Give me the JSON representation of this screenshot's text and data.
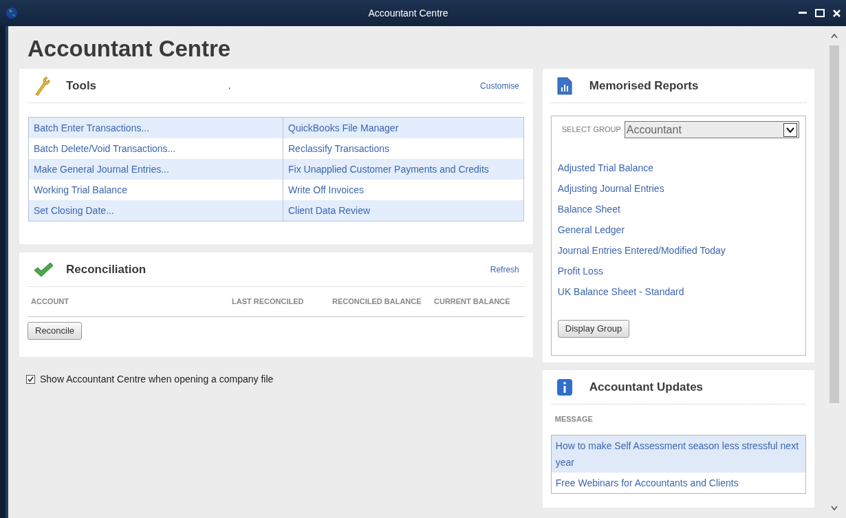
{
  "window": {
    "title": "Accountant Centre"
  },
  "heading": "Accountant Centre",
  "tools": {
    "title": "Tools",
    "marker": ".",
    "customise": "Customise",
    "rows": [
      [
        "Batch Enter Transactions...",
        "QuickBooks File Manager"
      ],
      [
        "Batch Delete/Void Transactions...",
        "Reclassify Transactions"
      ],
      [
        "Make General Journal Entries...",
        "Fix Unapplied Customer Payments and Credits"
      ],
      [
        "Working Trial Balance",
        "Write Off Invoices"
      ],
      [
        "Set Closing Date...",
        "Client Data Review"
      ]
    ]
  },
  "reconciliation": {
    "title": "Reconciliation",
    "refresh": "Refresh",
    "columns": [
      "ACCOUNT",
      "LAST RECONCILED",
      "RECONCILED BALANCE",
      "CURRENT BALANCE"
    ],
    "button": "Reconcile"
  },
  "show_on_open": {
    "label": "Show Accountant Centre when opening a company file",
    "checked": true
  },
  "memorised_reports": {
    "title": "Memorised Reports",
    "select_label": "SELECT GROUP",
    "group": "Accountant",
    "reports": [
      "Adjusted Trial Balance",
      "Adjusting Journal Entries",
      "Balance Sheet",
      "General Ledger",
      "Journal Entries Entered/Modified Today",
      "Profit Loss",
      "UK Balance Sheet - Standard"
    ],
    "button": "Display Group"
  },
  "updates": {
    "title": "Accountant Updates",
    "column": "MESSAGE",
    "messages": [
      "How to make Self Assessment season less stressful next year",
      "Free Webinars for Accountants and Clients"
    ]
  }
}
